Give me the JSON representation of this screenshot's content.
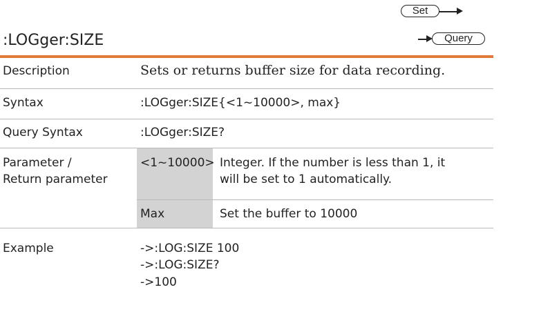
{
  "header": {
    "title": ":LOGger:SIZE",
    "set_label": "Set",
    "query_label": "Query"
  },
  "rows": {
    "description": {
      "label": "Description",
      "text": "Sets or returns buffer size for data recording."
    },
    "syntax": {
      "label": "Syntax",
      "text": ":LOGger:SIZE{<1~10000>, max}"
    },
    "query_syntax": {
      "label": "Query Syntax",
      "text": ":LOGger:SIZE?"
    },
    "parameter": {
      "label_line1": "Parameter /",
      "label_line2": "Return parameter",
      "entries": [
        {
          "param": "<1~10000>",
          "desc_line1": "Integer. If the number is less than 1, it",
          "desc_line2": "will be set to 1 automatically."
        },
        {
          "param": "Max",
          "desc_line1": "Set the buffer to 10000"
        }
      ]
    },
    "example": {
      "label": "Example",
      "lines": [
        "->:LOG:SIZE 100",
        "->:LOG:SIZE?",
        "->100"
      ]
    }
  },
  "colors": {
    "accent": "#e07a3a",
    "cell_gray": "#d3d3d3",
    "rule": "#b9b9b9"
  }
}
